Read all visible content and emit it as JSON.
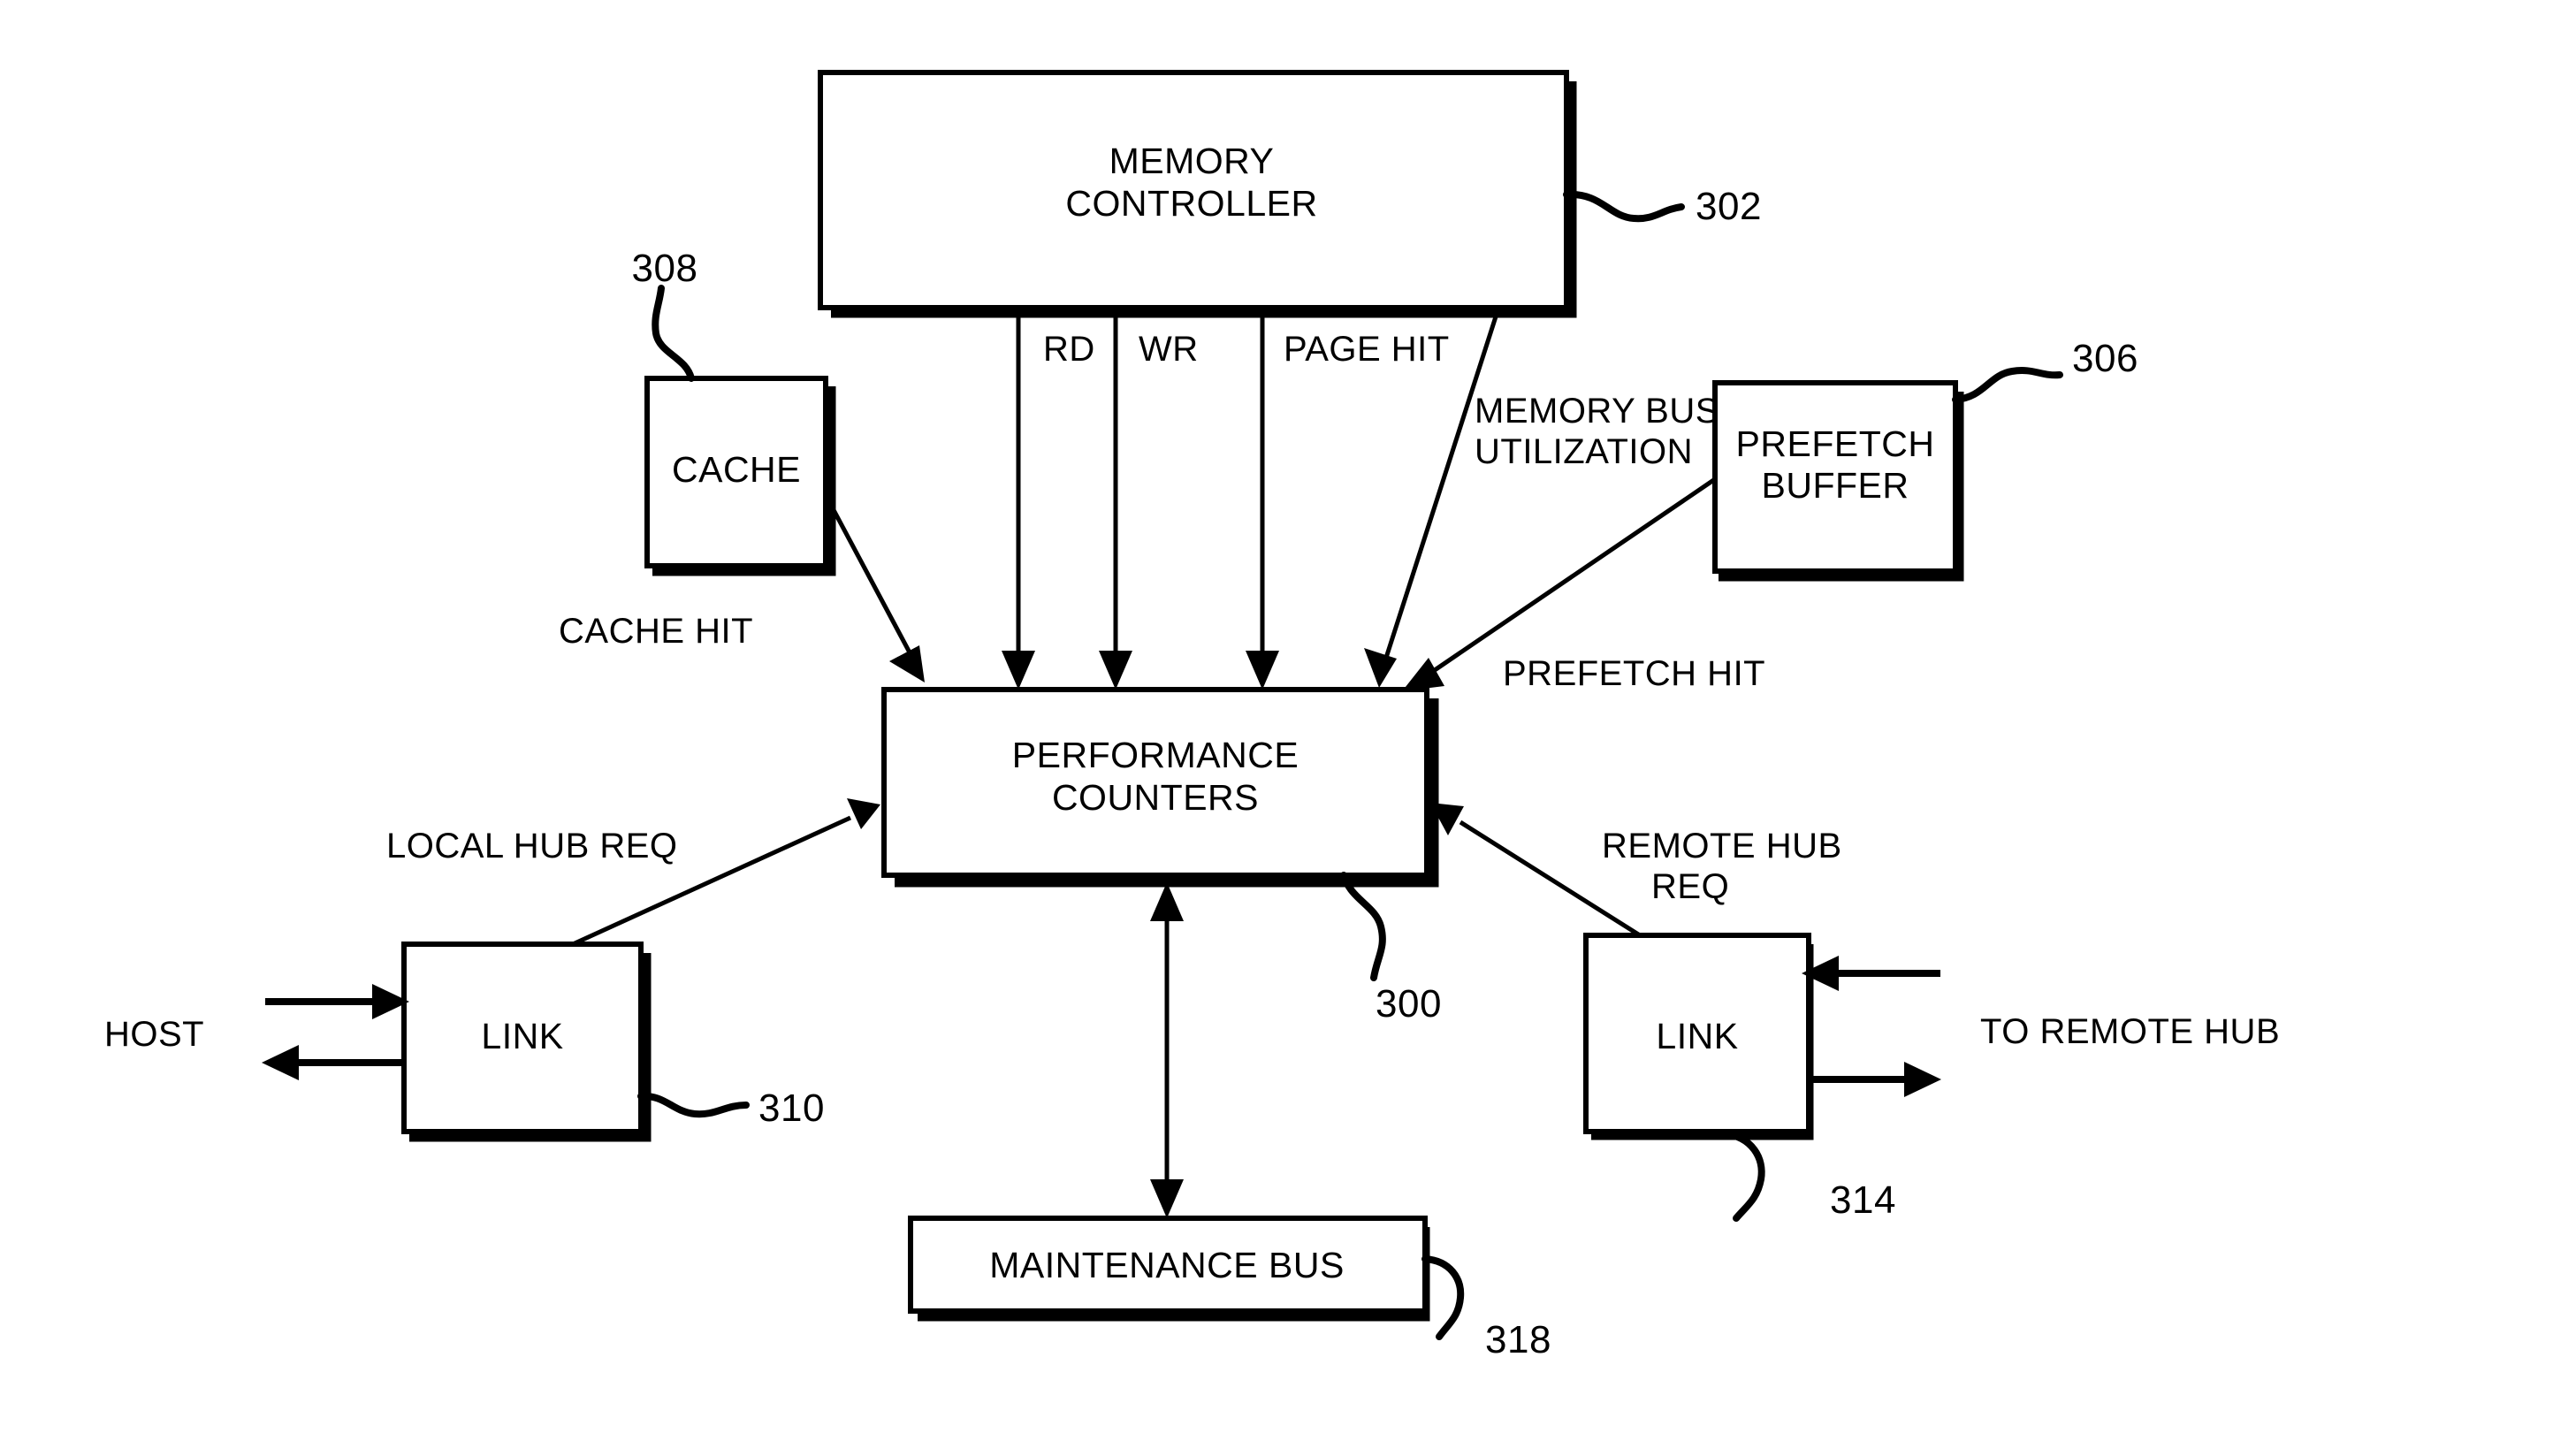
{
  "figure": {
    "title": "Performance Counters Hub Block Diagram",
    "blocks": {
      "memory_controller": {
        "line1": "MEMORY",
        "line2": "CONTROLLER",
        "ref": "302"
      },
      "cache": {
        "label": "CACHE",
        "ref": "308"
      },
      "prefetch_buffer": {
        "line1": "PREFETCH",
        "line2": "BUFFER",
        "ref": "306"
      },
      "performance_counters": {
        "line1": "PERFORMANCE",
        "line2": "COUNTERS",
        "ref": "300"
      },
      "link_left": {
        "label": "LINK",
        "ref": "310"
      },
      "link_right": {
        "label": "LINK",
        "ref": "314"
      },
      "maintenance_bus": {
        "label": "MAINTENANCE BUS",
        "ref": "318"
      }
    },
    "signals": {
      "rd": "RD",
      "wr": "WR",
      "page_hit": "PAGE HIT",
      "memory_bus_utilization_line1": "MEMORY BUS",
      "memory_bus_utilization_line2": "UTILIZATION",
      "prefetch_hit": "PREFETCH HIT",
      "cache_hit": "CACHE HIT",
      "local_hub_req": "LOCAL HUB REQ",
      "remote_hub_req_line1": "REMOTE HUB",
      "remote_hub_req_line2": "REQ",
      "host": "HOST",
      "to_remote_hub": "TO REMOTE HUB"
    },
    "colors": {
      "line": "#000000",
      "background": "#ffffff",
      "text": "#000000"
    }
  }
}
